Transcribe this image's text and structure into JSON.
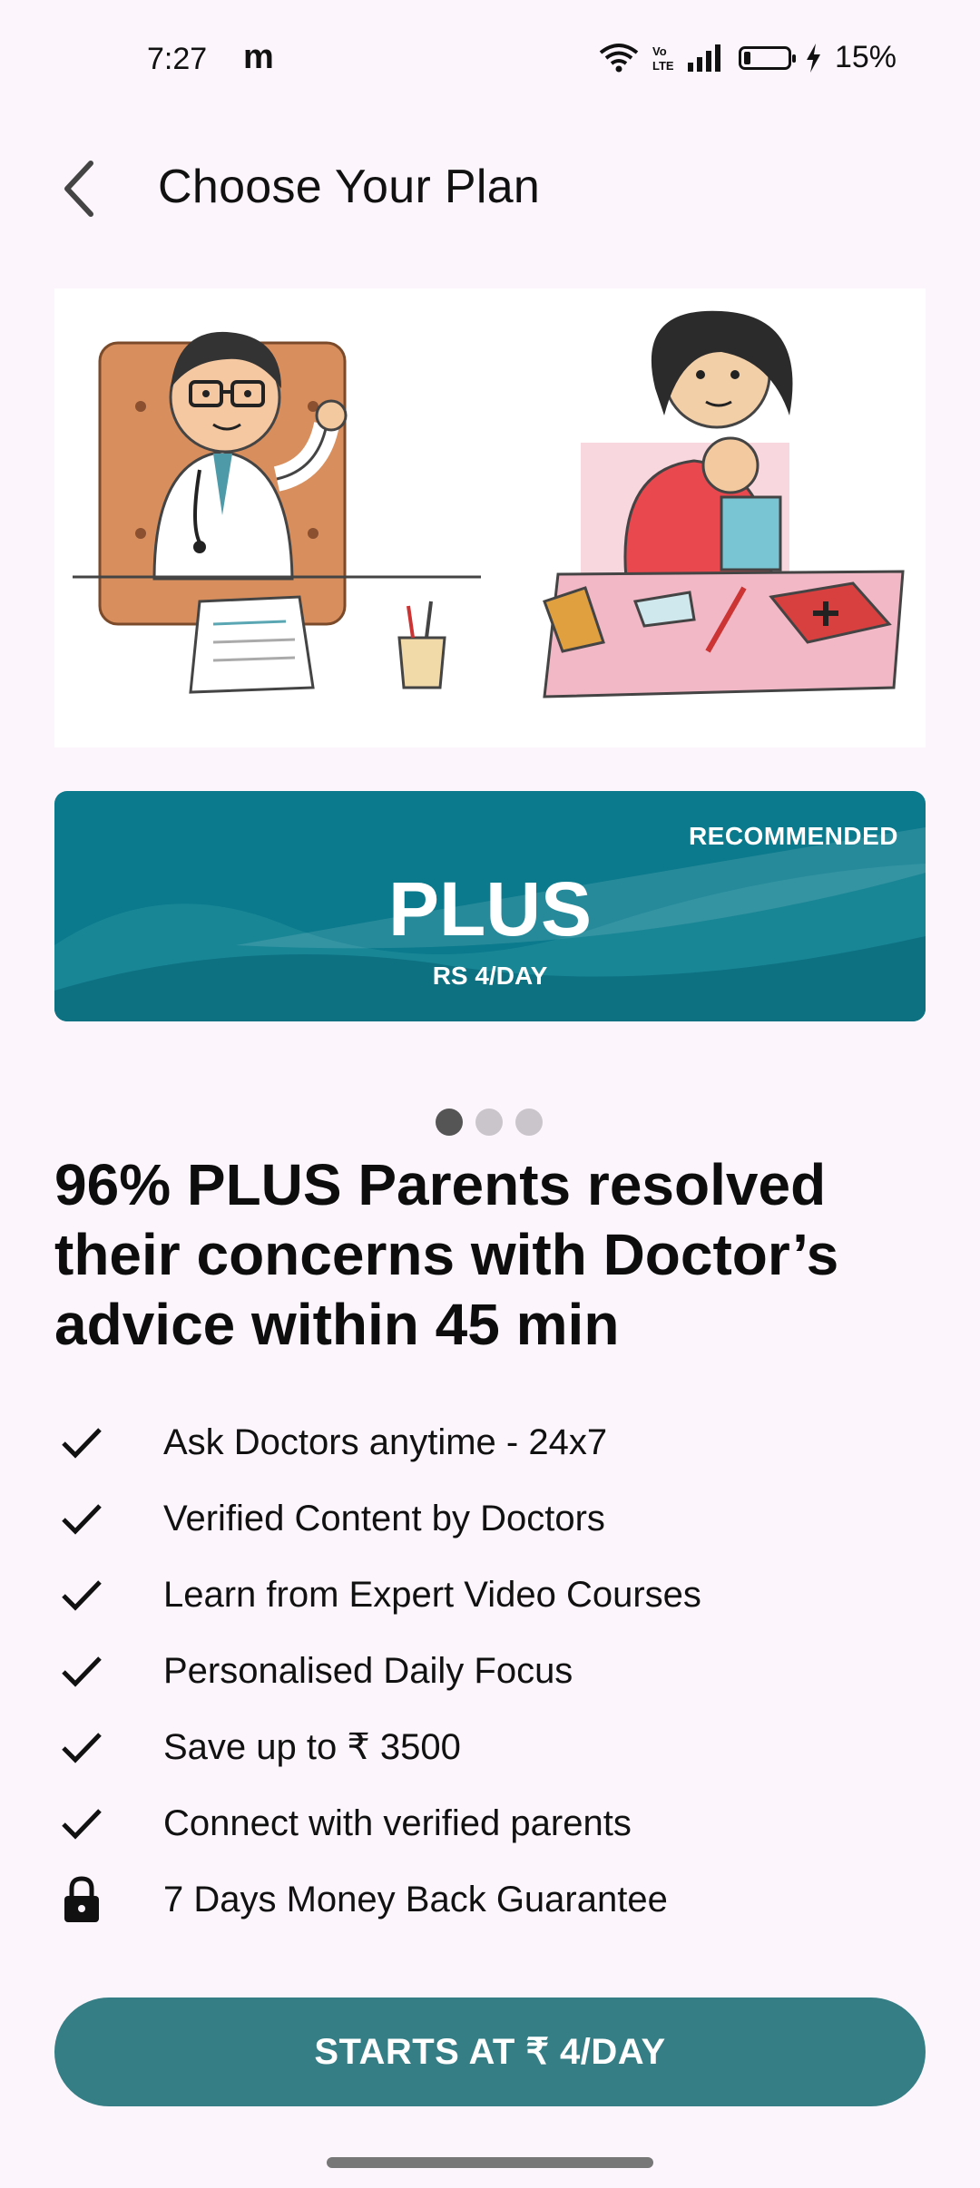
{
  "status_bar": {
    "time": "7:27",
    "app_glyph": "m",
    "battery_percent": "15%",
    "icons": [
      "wifi-icon",
      "volte-icon",
      "signal-icon",
      "battery-icon",
      "charging-icon"
    ]
  },
  "header": {
    "back_icon": "back-arrow-icon",
    "title": "Choose Your Plan"
  },
  "plan_card": {
    "badge": "RECOMMENDED",
    "name": "PLUS",
    "price": "RS 4/DAY",
    "color": "#0a7a8c"
  },
  "carousel": {
    "page_count": 3,
    "active_index": 0
  },
  "headline": "96% PLUS Parents resolved their concerns with Doctor’s advice within 45 min",
  "features": [
    {
      "icon": "check-icon",
      "text": "Ask Doctors anytime - 24x7"
    },
    {
      "icon": "check-icon",
      "text": "Verified Content by Doctors"
    },
    {
      "icon": "check-icon",
      "text": "Learn from Expert Video Courses"
    },
    {
      "icon": "check-icon",
      "text": "Personalised Daily Focus"
    },
    {
      "icon": "check-icon",
      "text": "Save up to ₹ 3500"
    },
    {
      "icon": "check-icon",
      "text": "Connect with verified parents"
    },
    {
      "icon": "lock-icon",
      "text": "7 Days Money Back Guarantee"
    }
  ],
  "cta": {
    "label": "STARTS AT ₹ 4/DAY",
    "color": "#367e86"
  }
}
